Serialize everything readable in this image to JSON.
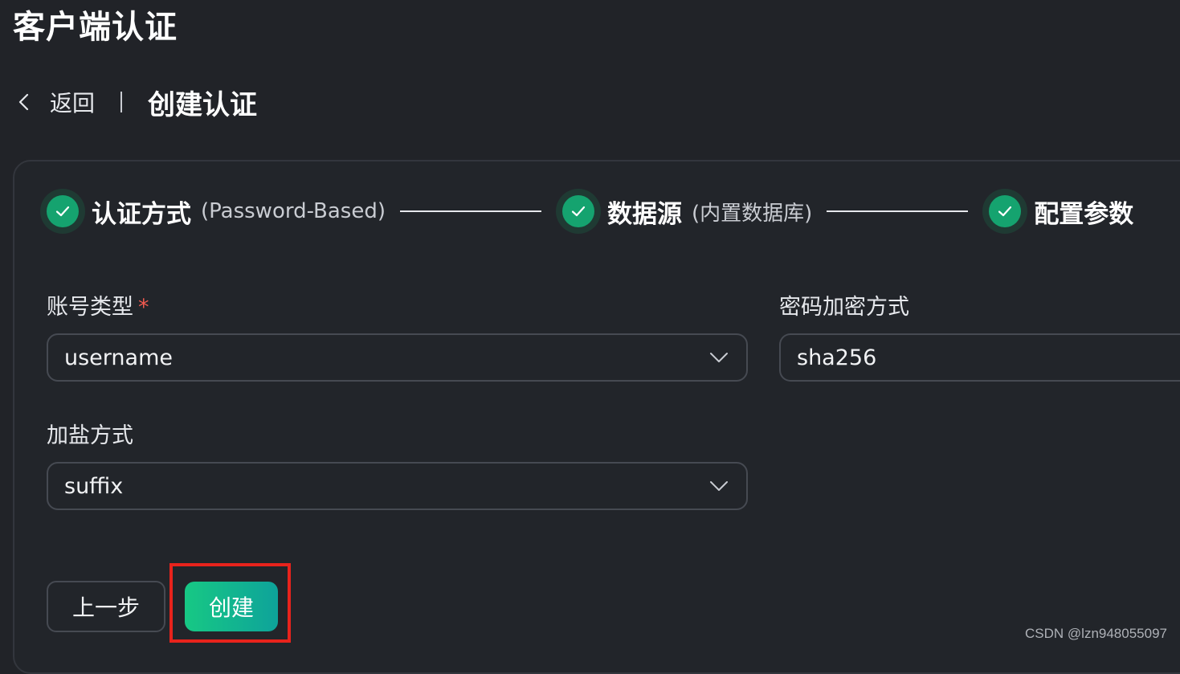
{
  "page": {
    "title": "客户端认证"
  },
  "breadcrumb": {
    "back_label": "返回",
    "current": "创建认证",
    "back_icon": "chevron-left-icon"
  },
  "steps": [
    {
      "title": "认证方式",
      "subtitle": "(Password-Based)",
      "status": "completed",
      "icon": "check-icon"
    },
    {
      "title": "数据源",
      "subtitle": "(内置数据库)",
      "status": "completed",
      "icon": "check-icon"
    },
    {
      "title": "配置参数",
      "subtitle": "",
      "status": "completed",
      "icon": "check-icon"
    }
  ],
  "form": {
    "account_type": {
      "label": "账号类型",
      "required_mark": "*",
      "value": "username"
    },
    "password_hash": {
      "label": "密码加密方式",
      "value": "sha256"
    },
    "salt_position": {
      "label": "加盐方式",
      "value": "suffix"
    }
  },
  "actions": {
    "prev_label": "上一步",
    "create_label": "创建"
  },
  "watermark": "CSDN @lzn948055097",
  "colors": {
    "background": "#212328",
    "accent": "#15a36f",
    "highlight": "#e8231c",
    "required": "#f05a4f"
  }
}
